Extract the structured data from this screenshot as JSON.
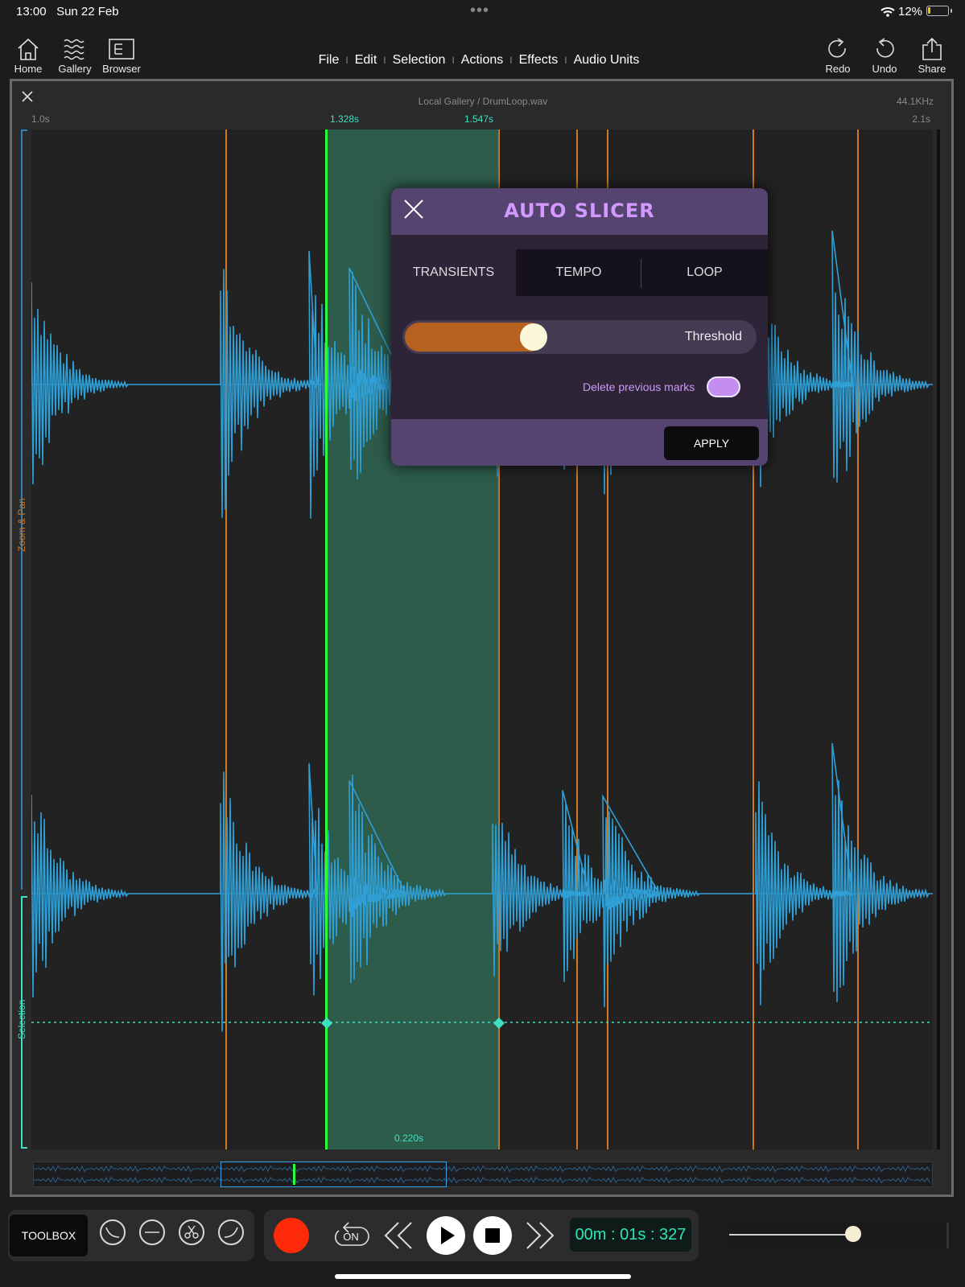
{
  "status_bar": {
    "time": "13:00",
    "date": "Sun 22 Feb",
    "multitask_dots": "•••",
    "battery_percent": "12%",
    "battery_level": 0.12
  },
  "toolbar": {
    "left": [
      {
        "label": "Home",
        "icon": "home-icon"
      },
      {
        "label": "Gallery",
        "icon": "waves-icon"
      },
      {
        "label": "Browser",
        "icon": "browser-icon"
      }
    ],
    "menu": [
      "File",
      "Edit",
      "Selection",
      "Actions",
      "Effects",
      "Audio Units"
    ],
    "menu_separator": "I",
    "right": [
      {
        "label": "Redo",
        "icon": "redo-icon"
      },
      {
        "label": "Undo",
        "icon": "undo-icon"
      },
      {
        "label": "Share",
        "icon": "share-icon"
      }
    ]
  },
  "editor": {
    "close_icon": "close-icon",
    "file_path": "Local Gallery / DrumLoop.wav",
    "sample_rate": "44.1KHz",
    "time_start": "1.0s",
    "time_end": "2.1s",
    "selection_start": "1.328s",
    "selection_end": "1.547s",
    "selection_length": "0.220s",
    "side_label_zoom": "Zoom & Pan",
    "side_label_selection": "Selection"
  },
  "auto_slicer": {
    "title": "AUTO SLICER",
    "tabs": [
      "TRANSIENTS",
      "TEMPO",
      "LOOP"
    ],
    "active_tab": "TRANSIENTS",
    "threshold_label": "Threshold",
    "threshold_value": 0.33,
    "delete_previous_marks_label": "Delete previous marks",
    "delete_previous_marks_on": true,
    "apply_label": "APPLY"
  },
  "bottom": {
    "toolbox_label": "TOOLBOX",
    "fade_tools": [
      "fade-in-icon",
      "silence-icon",
      "cut-icon",
      "fade-out-icon"
    ],
    "loop_label": "ON",
    "time": "00m : 01s : 327",
    "volume": 0.55
  },
  "colors": {
    "waveform": "#2f9fd6",
    "marker": "#d17a26",
    "selection_line": "#2cff3a",
    "selection_fill": "#388c6e",
    "dialog_accent": "#d29aff",
    "record": "#ff2a0a"
  }
}
